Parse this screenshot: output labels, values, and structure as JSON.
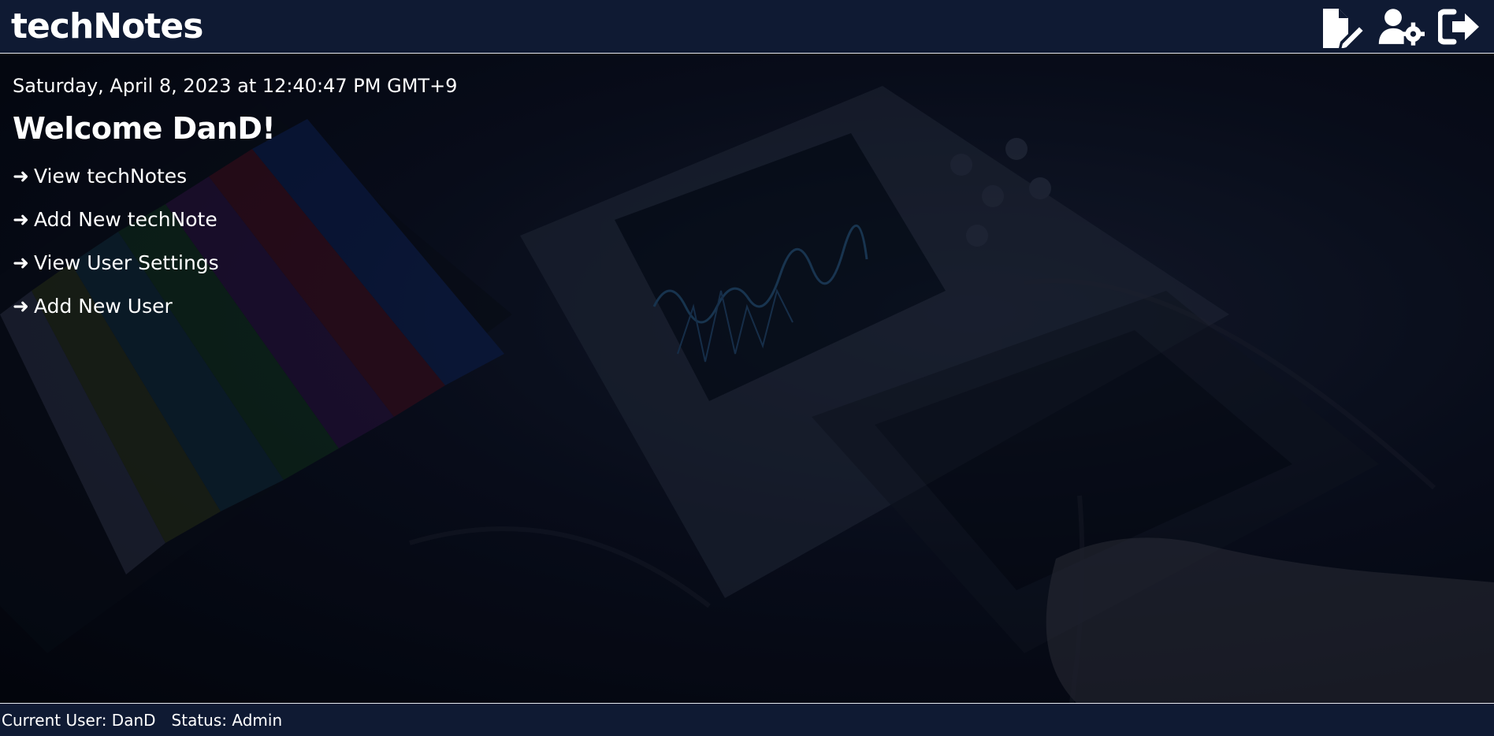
{
  "header": {
    "app_title": "techNotes",
    "actions": [
      {
        "icon": "file-pen-icon",
        "label": ""
      },
      {
        "icon": "user-gear-icon",
        "label": ""
      },
      {
        "icon": "sign-out-icon",
        "label": ""
      }
    ]
  },
  "main": {
    "datetime": "Saturday, April 8, 2023 at 12:40:47 PM GMT+9",
    "welcome": "Welcome DanD!",
    "links": [
      {
        "arrow": "➜",
        "label": "View techNotes"
      },
      {
        "arrow": "➜",
        "label": "Add New techNote"
      },
      {
        "arrow": "➜",
        "label": "View User Settings"
      },
      {
        "arrow": "➜",
        "label": "Add New User"
      }
    ]
  },
  "footer": {
    "current_user": "Current User: DanD",
    "status": "Status: Admin"
  },
  "colors": {
    "bar_background": "#0f1a33",
    "page_background": "#04070f",
    "text": "#ffffff",
    "divider": "#e8eaf0"
  }
}
